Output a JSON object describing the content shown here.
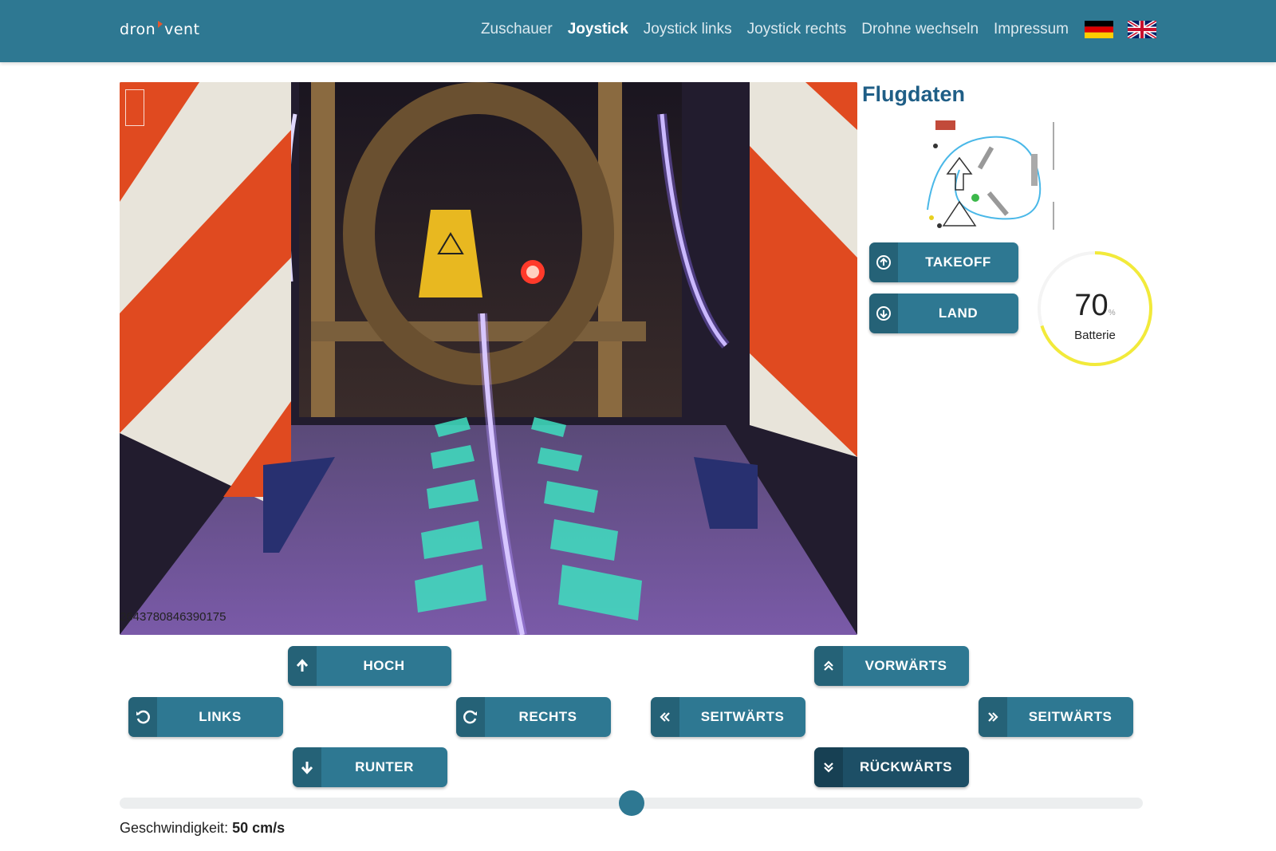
{
  "brand": {
    "logo_left": "dron",
    "logo_right": "vent"
  },
  "nav": {
    "items": [
      {
        "label": "Zuschauer",
        "active": false
      },
      {
        "label": "Joystick",
        "active": true
      },
      {
        "label": "Joystick links",
        "active": false
      },
      {
        "label": "Joystick rechts",
        "active": false
      },
      {
        "label": "Drohne wechseln",
        "active": false
      },
      {
        "label": "Impressum",
        "active": false
      }
    ],
    "flags": [
      "german-flag-icon",
      "uk-flag-icon"
    ]
  },
  "video": {
    "stream_id": "2643780846390175"
  },
  "flight": {
    "title": "Flugdaten",
    "takeoff_label": "TAKEOFF",
    "land_label": "LAND",
    "battery_value": "70",
    "battery_unit": "%",
    "battery_label": "Batterie",
    "battery_fraction": 0.7,
    "battery_color": "#f2ea3a"
  },
  "controls": {
    "hoch": "HOCH",
    "links": "LINKS",
    "rechts": "RECHTS",
    "runter": "RUNTER",
    "vorwaerts": "VORWÄRTS",
    "seitwaerts_left": "SEITWÄRTS",
    "seitwaerts_right": "SEITWÄRTS",
    "rueckwaerts": "RÜCKWÄRTS"
  },
  "speed": {
    "label": "Geschwindigkeit:",
    "value": "50 cm/s",
    "slider_fraction": 0.5
  },
  "colors": {
    "primary": "#2e7892",
    "primary_dark": "#1d4f66",
    "title": "#1f5e86"
  }
}
